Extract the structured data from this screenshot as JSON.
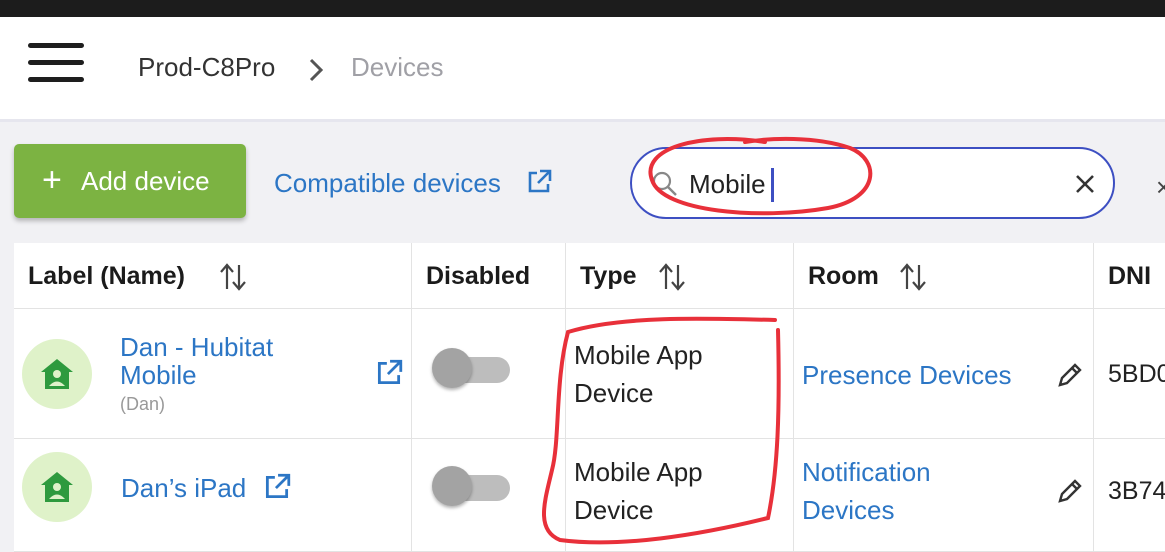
{
  "breadcrumb": {
    "hub": "Prod-C8Pro",
    "page": "Devices"
  },
  "toolbar": {
    "add_device_label": "Add device",
    "compatible_devices_label": "Compatible devices"
  },
  "search": {
    "value": "Mobile",
    "placeholder": ""
  },
  "table": {
    "columns": {
      "label": "Label (Name)",
      "disabled": "Disabled",
      "type": "Type",
      "room": "Room",
      "dni": "DNI"
    },
    "rows": [
      {
        "label_line1": "Dan - Hubitat",
        "label_line2": "Mobile",
        "name": "(Dan)",
        "disabled": false,
        "type_line1": "Mobile App",
        "type_line2": "Device",
        "room_line1": "Presence Devices",
        "room_line2": "",
        "dni": "5BD0"
      },
      {
        "label_line1": "Dan’s iPad",
        "label_line2": "",
        "name": "",
        "disabled": false,
        "type_line1": "Mobile App",
        "type_line2": "Device",
        "room_line1": "Notification",
        "room_line2": "Devices",
        "dni": "3B74"
      }
    ]
  },
  "colors": {
    "accent": "#7cb342",
    "link": "#2c76c5",
    "search_border": "#3d4fc2",
    "annotation": "#e8303a",
    "avatar_bg": "#dff2c9",
    "avatar_icon": "#2e9a3e"
  },
  "icons": [
    "menu-icon",
    "chevron-right-icon",
    "plus-icon",
    "external-link-icon",
    "search-icon",
    "close-icon",
    "sort-icon",
    "home-person-icon",
    "pencil-icon"
  ]
}
